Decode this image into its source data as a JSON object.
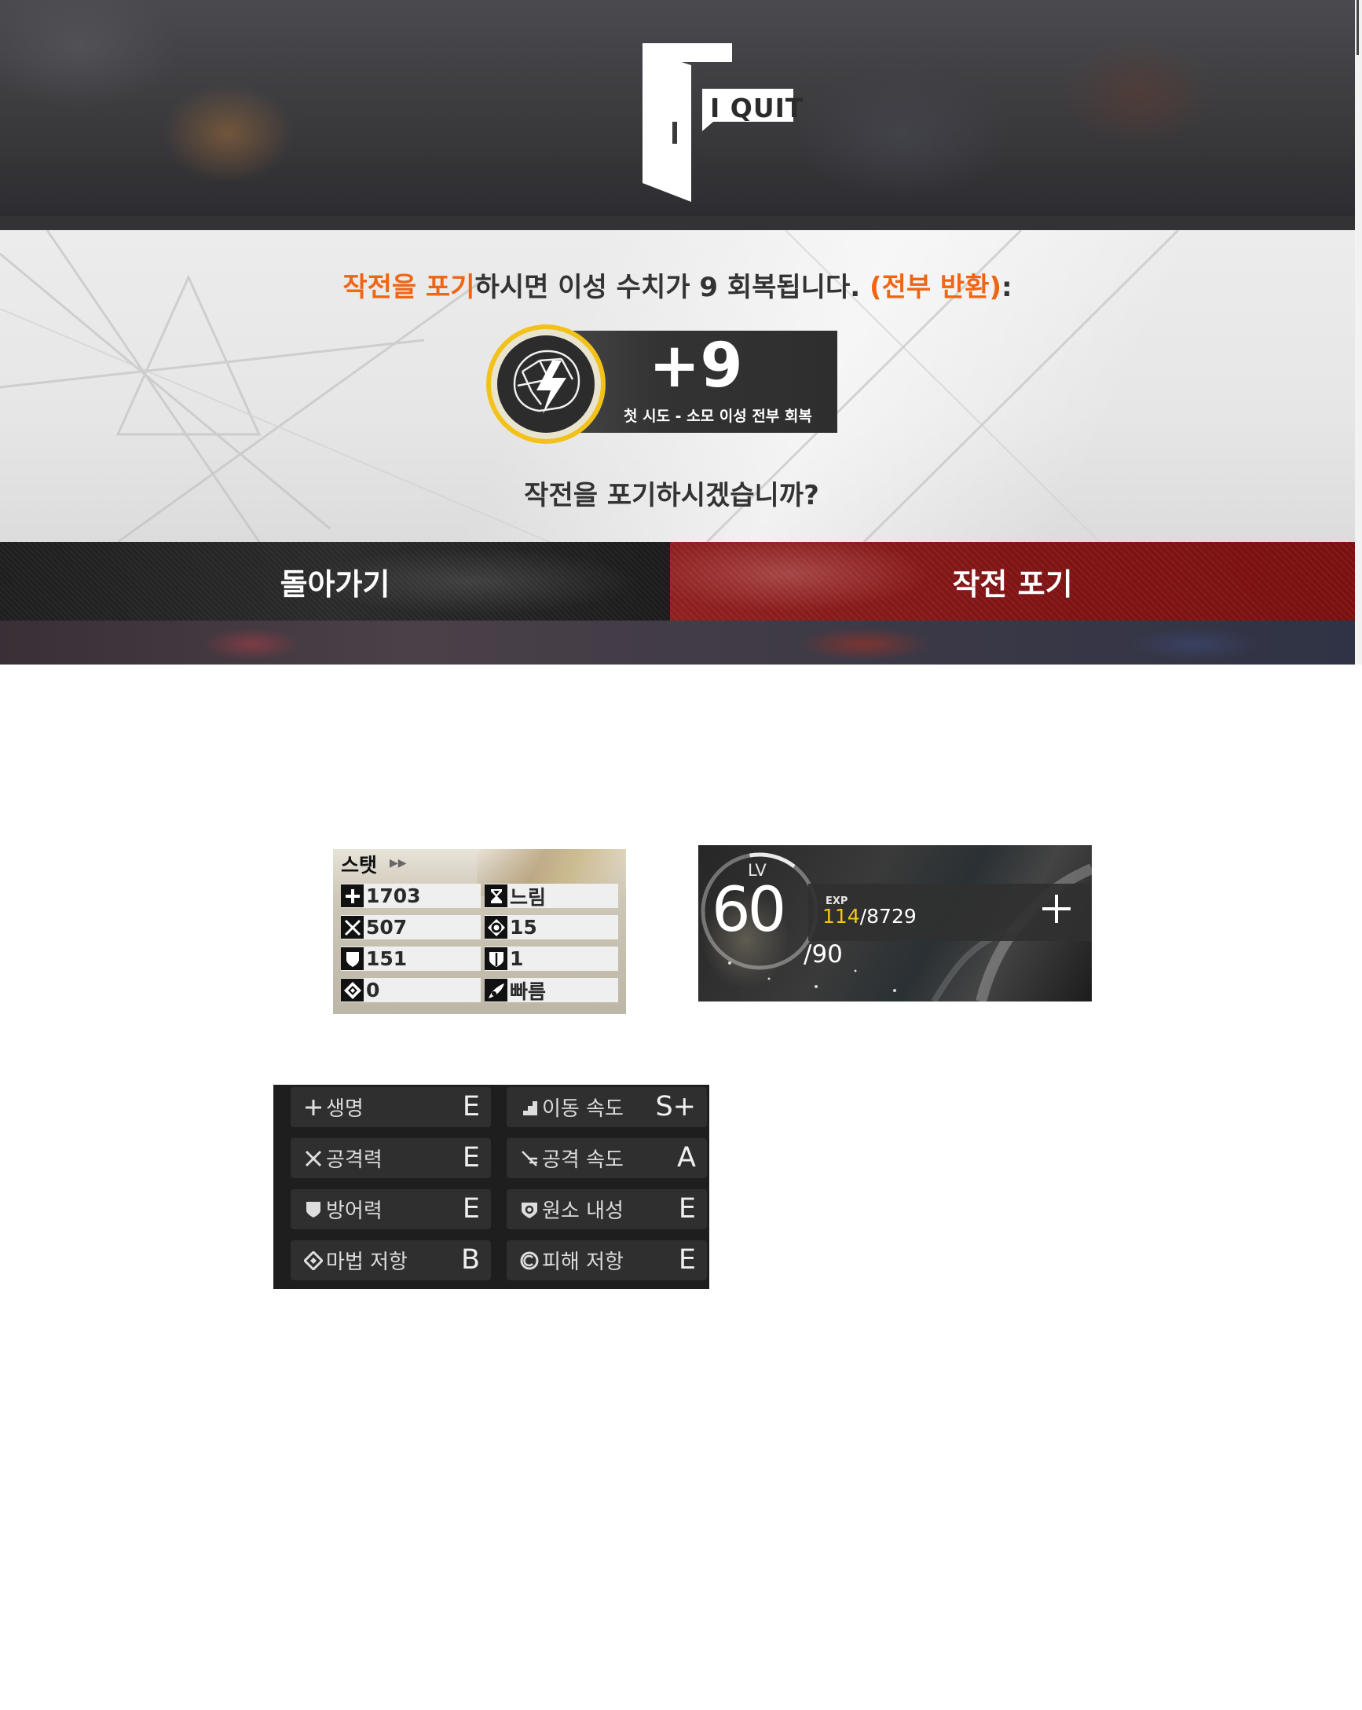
{
  "quit_dialog": {
    "logo_text": "I QUIT",
    "message": {
      "highlight_1": "작전을 포기",
      "middle": "하시면 이성 수치가 9 회복됩니다. ",
      "highlight_2": "(전부 반환)",
      "end": ":"
    },
    "reward": {
      "amount": "+9",
      "subtitle": "첫 시도 - 소모 이성 전부 회복",
      "icon": "sanity-brain-icon"
    },
    "confirm_question": "작전을 포기하시겠습니까?",
    "back_button": "돌아가기",
    "abandon_button": "작전 포기"
  },
  "stat_card": {
    "title": "스탯",
    "stats": [
      {
        "icon": "plus-icon",
        "value": "1703"
      },
      {
        "icon": "hourglass-icon",
        "value": "느림"
      },
      {
        "icon": "crossed-swords-icon",
        "value": "507"
      },
      {
        "icon": "target-icon",
        "value": "15"
      },
      {
        "icon": "shield-icon",
        "value": "151"
      },
      {
        "icon": "block-icon",
        "value": "1"
      },
      {
        "icon": "diamond-icon",
        "value": "0"
      },
      {
        "icon": "speed-icon",
        "value": "빠름"
      }
    ]
  },
  "level_card": {
    "lv_label": "LV",
    "level": "60",
    "max_level": "/90",
    "exp_label": "EXP",
    "exp_current": "114",
    "exp_total": "/8729"
  },
  "rank_panel": {
    "rows": [
      {
        "left": {
          "icon": "plus-icon",
          "label": "생명",
          "grade": "E"
        },
        "right": {
          "icon": "move-speed-icon",
          "label": "이동 속도",
          "grade": "S+"
        }
      },
      {
        "left": {
          "icon": "crossed-swords-icon",
          "label": "공격력",
          "grade": "E"
        },
        "right": {
          "icon": "attack-speed-icon",
          "label": "공격 속도",
          "grade": "A"
        }
      },
      {
        "left": {
          "icon": "shield-icon",
          "label": "방어력",
          "grade": "E"
        },
        "right": {
          "icon": "element-resist-icon",
          "label": "원소 내성",
          "grade": "E"
        }
      },
      {
        "left": {
          "icon": "diamond-icon",
          "label": "마법 저항",
          "grade": "B"
        },
        "right": {
          "icon": "damage-resist-icon",
          "label": "피해 저항",
          "grade": "E"
        }
      }
    ]
  },
  "colors": {
    "highlight": "#f06514",
    "abandon_red": "#801414",
    "exp_yellow": "#f5c518"
  }
}
